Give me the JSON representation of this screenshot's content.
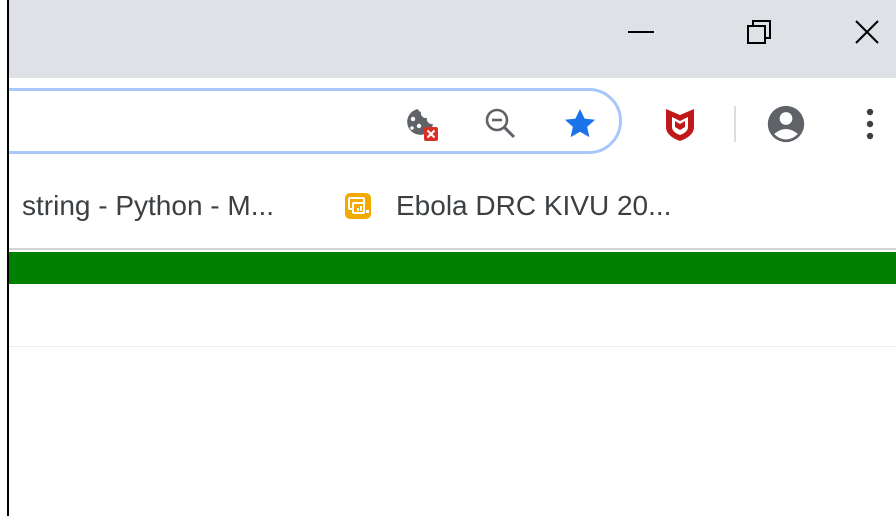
{
  "window": {
    "controls": {
      "minimize": "minimize-icon",
      "restore": "restore-icon",
      "close": "close-icon"
    },
    "titlebar_color": "#dee1e6"
  },
  "omnibox": {
    "border_color": "#a8c7fa",
    "icons": [
      "cookie-blocked-icon",
      "zoom-out-icon",
      "bookmark-star-icon"
    ],
    "star_color": "#1a73e8"
  },
  "extensions": {
    "mcafee": {
      "icon": "mcafee-shield-icon",
      "color": "#c01818"
    },
    "profile": {
      "icon": "account-avatar-icon"
    },
    "menu": {
      "icon": "kebab-menu-icon"
    }
  },
  "bookmarks": [
    {
      "label": "string - Python - M...",
      "favicon": "none"
    },
    {
      "label": "Ebola DRC KIVU 20...",
      "favicon": "dashboard-favicon"
    }
  ],
  "page": {
    "banner_color": "#008000"
  }
}
